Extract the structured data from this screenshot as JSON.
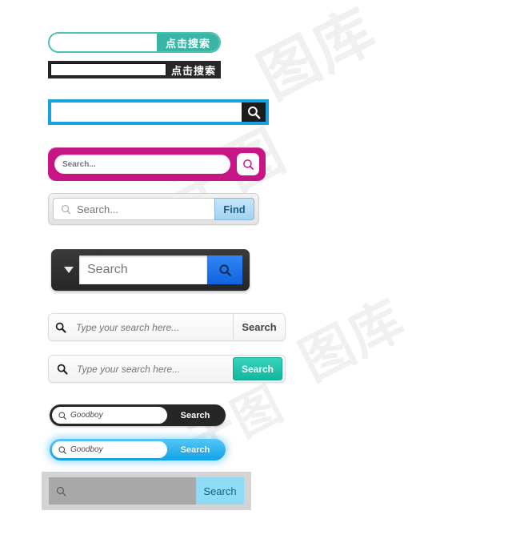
{
  "watermark": {
    "text_a": "图库",
    "text_b": "图库",
    "text_c": "千图",
    "text_d": "千图"
  },
  "colors": {
    "teal": "#38b5a5",
    "black": "#272727",
    "blue": "#1ba1e2",
    "magenta": "#c71585",
    "find_blue": "#a2d2ef",
    "button_blue": "#1263e0",
    "teal_button": "#14b69e",
    "pill_blue": "#12a2e8",
    "grey": "#d4d4d4",
    "light_blue": "#8ddbf5"
  },
  "bars": [
    {
      "id": "teal-pill",
      "input_value": "",
      "input_placeholder": "",
      "button_label": "点击搜索",
      "icon": ""
    },
    {
      "id": "black-rect",
      "input_value": "",
      "input_placeholder": "",
      "button_label": "点击搜索",
      "icon": ""
    },
    {
      "id": "blue-border",
      "input_value": "",
      "input_placeholder": "",
      "button_label": "",
      "icon": "search-icon"
    },
    {
      "id": "magenta",
      "input_value": "",
      "input_placeholder": "Search...",
      "button_label": "",
      "icon": "search-icon"
    },
    {
      "id": "find",
      "input_value": "",
      "input_placeholder": "Search...",
      "button_label": "Find",
      "icon": "search-icon"
    },
    {
      "id": "dark-dropdown",
      "input_value": "",
      "input_placeholder": "Search",
      "button_label": "",
      "icon": "search-icon",
      "dropdown_icon": "chevron-down-icon"
    },
    {
      "id": "white-search",
      "input_value": "",
      "input_placeholder": "Type your search here...",
      "button_label": "Search",
      "icon": "search-icon"
    },
    {
      "id": "teal-search",
      "input_value": "",
      "input_placeholder": "Type your search here...",
      "button_label": "Search",
      "icon": "search-icon"
    },
    {
      "id": "black-pill",
      "input_value": "Goodboy",
      "input_placeholder": "",
      "button_label": "Search",
      "icon": "search-icon"
    },
    {
      "id": "blue-pill",
      "input_value": "Goodboy",
      "input_placeholder": "",
      "button_label": "Search",
      "icon": "search-icon"
    },
    {
      "id": "grey-block",
      "input_value": "",
      "input_placeholder": "",
      "button_label": "Search",
      "icon": "search-icon"
    }
  ]
}
